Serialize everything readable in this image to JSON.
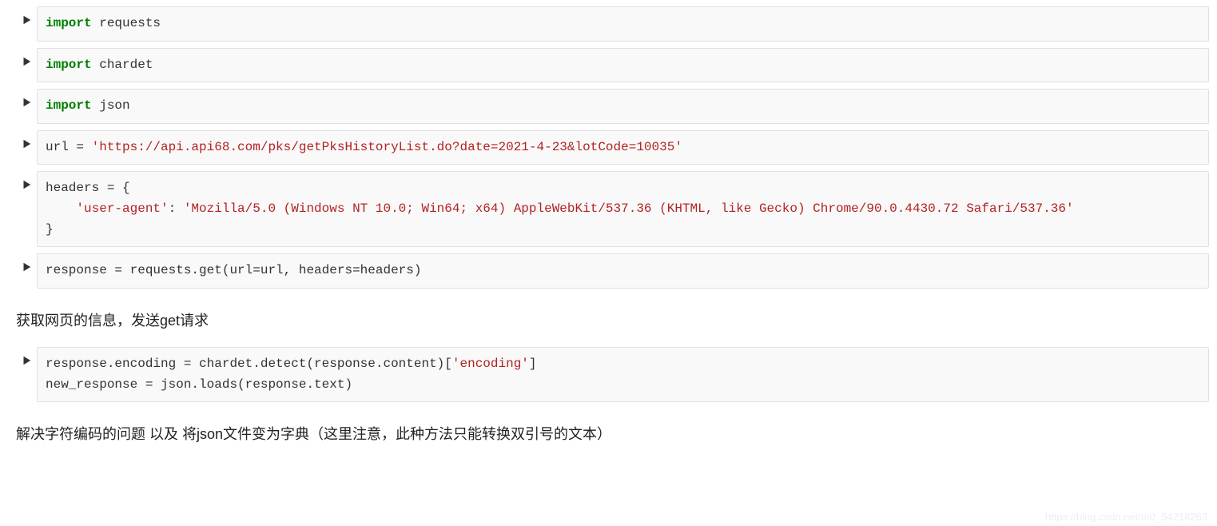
{
  "cells": {
    "c1": {
      "kw": "import",
      "mod": " requests"
    },
    "c2": {
      "kw": "import",
      "mod": " chardet"
    },
    "c3": {
      "kw": "import",
      "mod": " json"
    },
    "c4": {
      "pre": "url = ",
      "str": "'https://api.api68.com/pks/getPksHistoryList.do?date=2021-4-23&lotCode=10035'"
    },
    "c5": {
      "l1": "headers = {",
      "indent": "    ",
      "key": "'user-agent'",
      "colon": ": ",
      "val": "'Mozilla/5.0 (Windows NT 10.0; Win64; x64) AppleWebKit/537.36 (KHTML, like Gecko) Chrome/90.0.4430.72 Safari/537.36'",
      "l3": "}"
    },
    "c6": {
      "t1": "response = requests.get(url=url, headers=headers)"
    },
    "md1": "获取网页的信息，发送get请求",
    "c7": {
      "l1a": "response.encoding = chardet.detect(response.content)[",
      "l1b": "'encoding'",
      "l1c": "]",
      "l2": "new_response = json.loads(response.text)"
    },
    "md2": "解决字符编码的问题 以及 将json文件变为字典（这里注意，此种方法只能转换双引号的文本）"
  },
  "watermark": "https://blog.csdn.net/m0_54218263"
}
